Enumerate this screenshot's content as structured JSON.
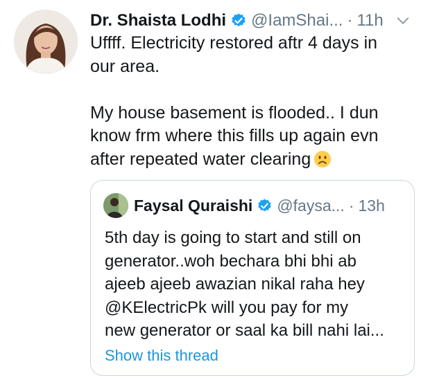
{
  "tweet": {
    "author_name": "Dr. Shaista Lodhi",
    "handle": "@IamShai...",
    "separator": "·",
    "time": "11h",
    "verified": true,
    "menu_icon": "chevron-down-icon",
    "text_lines": [
      "Uffff. Electricity restored aftr 4 days in",
      "our area.",
      "",
      "My house basement is flooded.. I dun",
      "know frm where this fills up again evn",
      "after repeated water clearing"
    ],
    "emoji": "frowning-face-emoji"
  },
  "quoted_tweet": {
    "author_name": "Faysal Quraishi",
    "handle": "@faysa...",
    "separator": "·",
    "time": "13h",
    "verified": true,
    "text_lines": [
      "5th day is going to start and still on",
      "generator..woh bechara bhi bhi ab",
      "ajeeb ajeeb awazian nikal raha hey",
      "@KElectricPk will you pay for my",
      "new generator or saal ka bill nahi lai..."
    ],
    "show_thread_label": "Show this thread"
  },
  "colors": {
    "text": "#14171a",
    "secondary": "#657786",
    "link": "#1b95e0",
    "verified": "#1da1f2",
    "border": "#ccd6dd"
  }
}
